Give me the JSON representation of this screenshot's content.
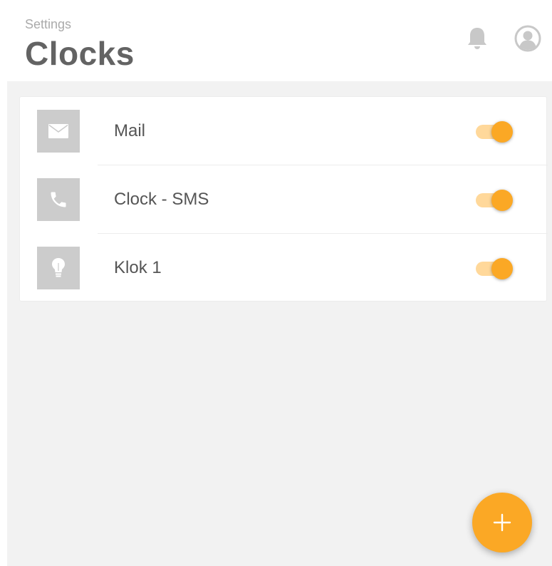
{
  "header": {
    "breadcrumb": "Settings",
    "title": "Clocks",
    "icons": {
      "notifications": "bell-icon",
      "profile": "user-avatar-icon"
    }
  },
  "clocks": [
    {
      "label": "Mail",
      "icon": "mail-icon",
      "enabled": true
    },
    {
      "label": "Clock - SMS",
      "icon": "phone-icon",
      "enabled": true
    },
    {
      "label": "Klok 1",
      "icon": "lightbulb-icon",
      "enabled": true
    }
  ],
  "fab": {
    "icon": "plus-icon"
  },
  "colors": {
    "accent": "#fba825",
    "toggle_track": "#ffd89a",
    "icon_tile": "#cccccc",
    "background": "#f2f2f2",
    "title_text": "#636363",
    "breadcrumb_text": "#aaaaaa"
  }
}
